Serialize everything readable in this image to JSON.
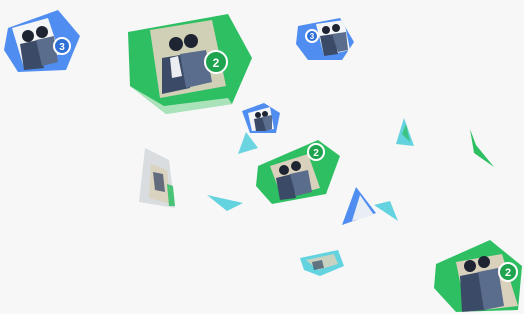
{
  "scene": {
    "background": "#f7f7f7",
    "description_free": true,
    "palette": {
      "green": "#2fbf63",
      "green_dark": "#1ea34e",
      "blue": "#4f8df0",
      "blue_dark": "#2f6fd6",
      "teal": "#62d3df",
      "grey": "#d9dde0",
      "skin": "#d9d1bc",
      "suit_dark": "#3b4a67",
      "suit_mid": "#5a6d8c",
      "hair": "#1f2433",
      "white": "#ffffff"
    },
    "flyers": [
      {
        "id": "flyer-large-green-top",
        "variant": "green",
        "badge_text": "2"
      },
      {
        "id": "flyer-blue-top-left",
        "variant": "blue",
        "badge_text": "3"
      },
      {
        "id": "flyer-blue-top-right",
        "variant": "blue",
        "badge_text": "3"
      },
      {
        "id": "flyer-green-center",
        "variant": "green",
        "badge_text": "2"
      },
      {
        "id": "flyer-blue-small-center",
        "variant": "blue",
        "badge_text": ""
      },
      {
        "id": "flyer-green-bottom-right",
        "variant": "green",
        "badge_text": "2"
      }
    ],
    "shards": [
      {
        "id": "shard-teal-center",
        "color": "#62d3df"
      },
      {
        "id": "shard-grey-left",
        "color": "#d9dde0"
      },
      {
        "id": "shard-teal-low",
        "color": "#62d3df"
      },
      {
        "id": "shard-blue-low",
        "color": "#4f8df0"
      },
      {
        "id": "shard-teal-low-2",
        "color": "#62d3df"
      },
      {
        "id": "shard-green-right",
        "color": "#2fbf63"
      },
      {
        "id": "shard-teal-right",
        "color": "#62d3df"
      },
      {
        "id": "shard-teal-bottom",
        "color": "#62d3df"
      }
    ]
  }
}
